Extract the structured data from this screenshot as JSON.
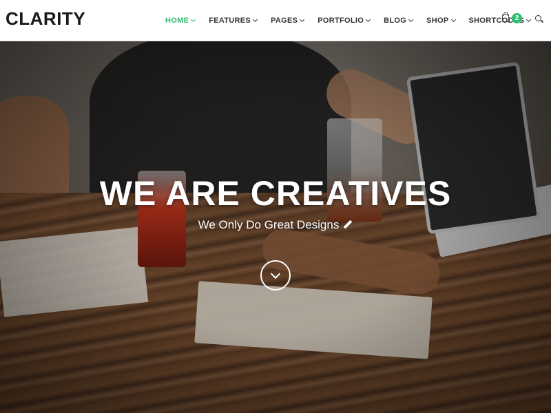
{
  "brand": {
    "logo": "CLARITY",
    "accent": "#2fbf71"
  },
  "nav": {
    "items": [
      {
        "label": "HOME",
        "active": true
      },
      {
        "label": "FEATURES",
        "active": false
      },
      {
        "label": "PAGES",
        "active": false
      },
      {
        "label": "PORTFOLIO",
        "active": false
      },
      {
        "label": "BLOG",
        "active": false
      },
      {
        "label": "SHOP",
        "active": false
      },
      {
        "label": "SHORTCODES",
        "active": false
      }
    ],
    "cart_count": "2",
    "cart_icon": "shopping-bag-icon",
    "search_icon": "search-icon"
  },
  "hero": {
    "title": "WE ARE CREATIVES",
    "subtitle": "We Only Do Great Designs",
    "subtitle_icon": "pencil-icon",
    "scroll_icon": "chevron-down-icon"
  }
}
